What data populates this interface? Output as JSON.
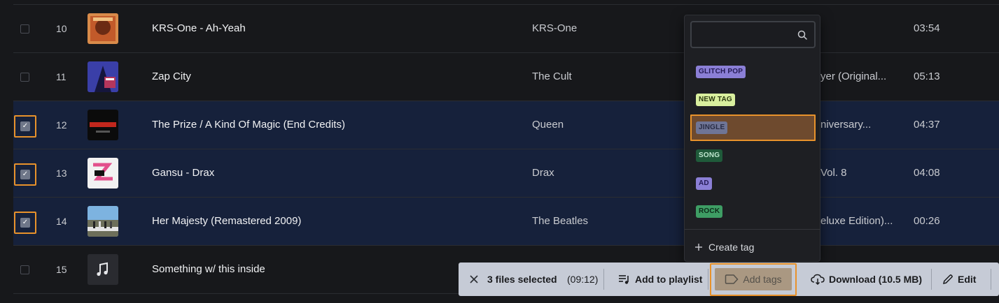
{
  "rows": [
    {
      "num": "10",
      "title": "KRS-One - Ah-Yeah",
      "artist": "KRS-One",
      "album": "",
      "duration": "03:54",
      "selected": false,
      "art": "krs-one-cover"
    },
    {
      "num": "11",
      "title": "Zap City",
      "artist": "The Cult",
      "album": "yer (Original...",
      "duration": "05:13",
      "selected": false,
      "art": "zap-city-cover"
    },
    {
      "num": "12",
      "title": "The Prize / A Kind Of Magic (End Credits)",
      "artist": "Queen",
      "album": "niversary...",
      "duration": "04:37",
      "selected": true,
      "art": "highlander-cover"
    },
    {
      "num": "13",
      "title": "Gansu - Drax",
      "artist": "Drax",
      "album": "Vol. 8",
      "duration": "04:08",
      "selected": true,
      "art": "vol-8-cover"
    },
    {
      "num": "14",
      "title": "Her Majesty (Remastered 2009)",
      "artist": "The Beatles",
      "album": "eluxe Edition)...",
      "duration": "00:26",
      "selected": true,
      "art": "abbey-road-cover"
    },
    {
      "num": "15",
      "title": "Something w/ this inside",
      "artist": "",
      "album": "",
      "duration": "",
      "selected": false,
      "art": "music-note-icon"
    }
  ],
  "checkbox_check": "✓",
  "tag_dropdown": {
    "search_value": "",
    "search_placeholder": "",
    "tags": [
      {
        "label": "GLITCH POP",
        "bg": "#8b7fd6",
        "fg": "#241a55",
        "highlighted": false
      },
      {
        "label": "NEW TAG",
        "bg": "#d9ef9e",
        "fg": "#2c3a10",
        "highlighted": false
      },
      {
        "label": "JINGLE",
        "bg": "#6f7596",
        "fg": "#282c44",
        "highlighted": true
      },
      {
        "label": "SONG",
        "bg": "#1f5a3a",
        "fg": "#bfe7cf",
        "highlighted": false
      },
      {
        "label": "AD",
        "bg": "#8b7fd6",
        "fg": "#241a55",
        "highlighted": false
      },
      {
        "label": "ROCK",
        "bg": "#3e9d64",
        "fg": "#0d2a19",
        "highlighted": false
      }
    ],
    "create_label": "Create tag"
  },
  "action_bar": {
    "selected_label": "3 files selected",
    "duration": "(09:12)",
    "add_to_playlist": "Add to playlist",
    "add_tags": "Add tags",
    "download": "Download (10.5 MB)",
    "edit": "Edit"
  },
  "colors": {
    "background": "#17181b",
    "selected_row": "#16213b",
    "highlight_border": "#e8922b",
    "action_bar": "#c6cbd6"
  }
}
